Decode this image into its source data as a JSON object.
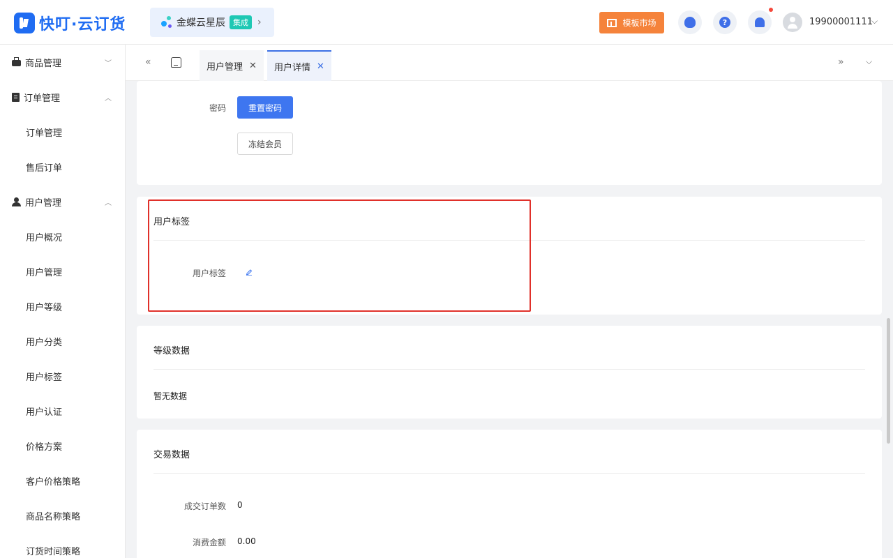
{
  "app": {
    "logo_text": "快叮·云订货",
    "partner_name": "金蝶云星辰",
    "partner_badge": "集成",
    "market_label": "模板市场",
    "help_glyph": "?",
    "username": "19900001111"
  },
  "sidebar": {
    "groups": [
      {
        "label": "商品管理",
        "icon": "bag-icon",
        "expanded": false
      },
      {
        "label": "订单管理",
        "icon": "clipboard-icon",
        "expanded": true
      },
      {
        "label": "用户管理",
        "icon": "user-icon",
        "expanded": true
      }
    ],
    "order_items": [
      "订单管理",
      "售后订单"
    ],
    "user_items": [
      "用户概况",
      "用户管理",
      "用户等级",
      "用户分类",
      "用户标签",
      "用户认证",
      "价格方案",
      "客户价格策略",
      "商品名称策略",
      "订货时间策略"
    ]
  },
  "tabs": [
    {
      "label": "用户管理",
      "active": false
    },
    {
      "label": "用户详情",
      "active": true
    }
  ],
  "account": {
    "password_label": "密码",
    "reset_password": "重置密码",
    "freeze_member": "冻结会员"
  },
  "tags_section": {
    "title": "用户标签",
    "field_label": "用户标签"
  },
  "level_section": {
    "title": "等级数据",
    "empty_text": "暂无数据"
  },
  "trade_section": {
    "title": "交易数据",
    "order_count_label": "成交订单数",
    "order_count_value": "0",
    "spend_label": "消费金额",
    "spend_value": "0.00"
  },
  "colors": {
    "primary": "#3e76f0",
    "highlight_border": "#e0302a",
    "market_button": "#f5833b"
  }
}
